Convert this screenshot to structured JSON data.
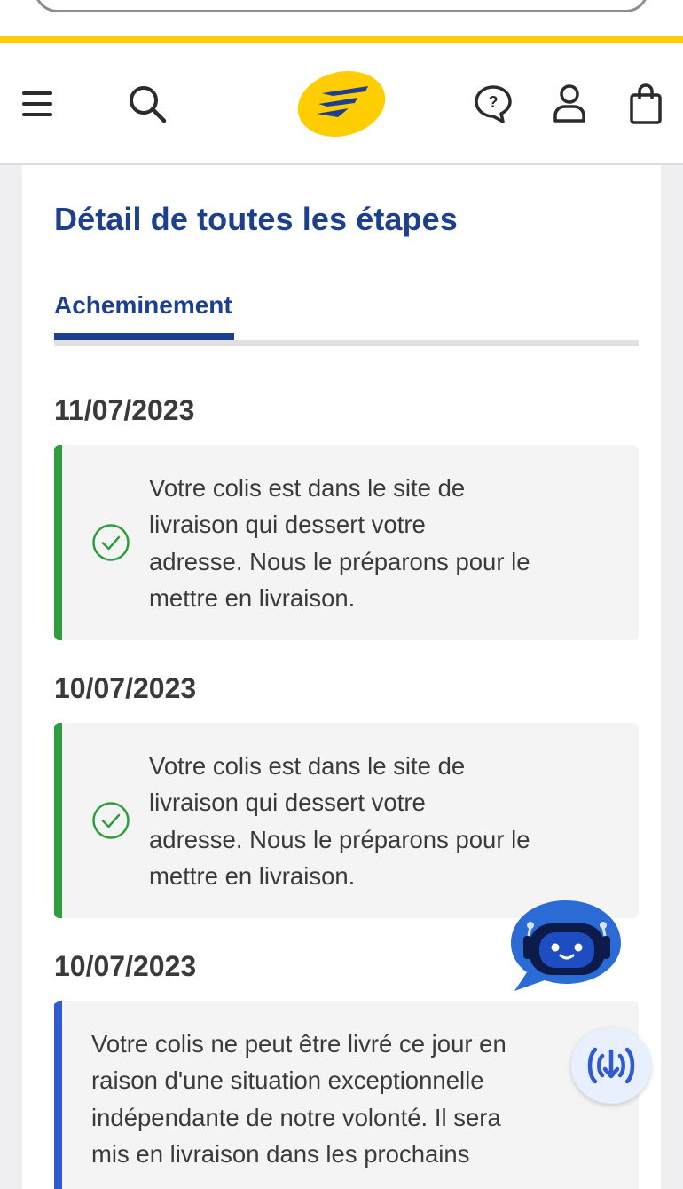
{
  "header": {
    "menu_icon": "hamburger-menu-icon",
    "search_icon": "search-icon",
    "logo": "la-poste-logo",
    "help_icon": "help-bubble-icon",
    "account_icon": "user-account-icon",
    "cart_icon": "shopping-bag-icon",
    "brand_yellow": "#ffcd00",
    "brand_blue": "#1d3f8f"
  },
  "section": {
    "title": "Détail de toutes les étapes",
    "tab_label": "Acheminement"
  },
  "events": [
    {
      "date": "11/07/2023",
      "status": "done",
      "color": "#2e9e3c",
      "lines": [
        "Votre colis est dans le site de",
        "livraison qui dessert votre",
        "adresse. Nous le préparons pour le",
        "mettre en livraison."
      ]
    },
    {
      "date": "10/07/2023",
      "status": "done",
      "color": "#2e9e3c",
      "lines": [
        "Votre colis est dans le site de",
        "livraison qui dessert votre",
        "adresse. Nous le préparons pour le",
        "mettre en livraison."
      ]
    },
    {
      "date": "10/07/2023",
      "status": "info",
      "color": "#2f5ad0",
      "lines": [
        "Votre colis ne peut être livré ce jour en",
        "raison d'une situation exceptionnelle",
        "indépendante de notre volonté. Il sera",
        "mis en livraison dans les prochains"
      ]
    }
  ],
  "floating": {
    "chatbot_icon": "chatbot-robot-icon",
    "audio_icon": "audio-download-icon"
  }
}
